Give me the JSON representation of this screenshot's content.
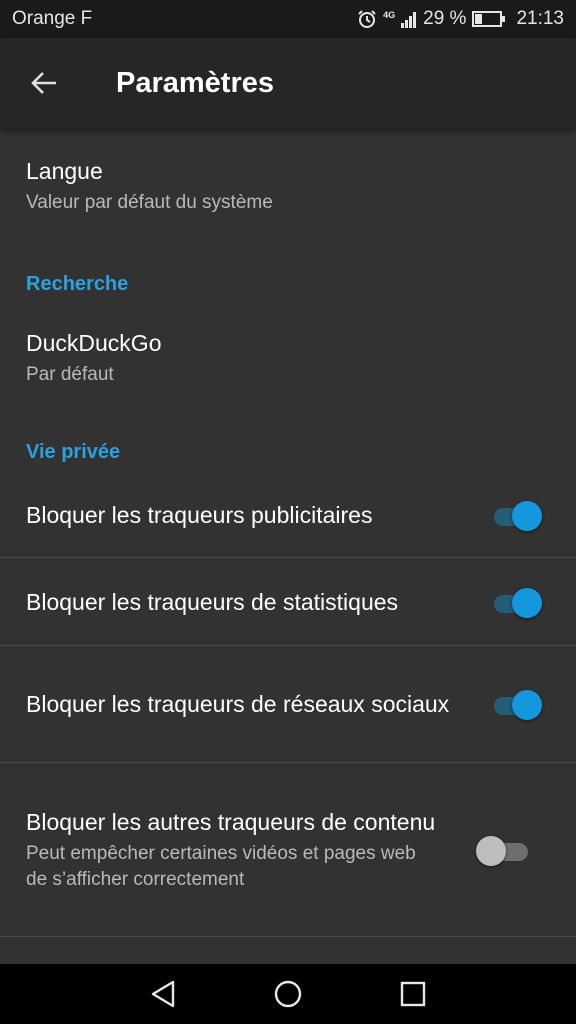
{
  "status_bar": {
    "carrier": "Orange F",
    "network": "4G",
    "battery": "29 %",
    "battery_level": 0.29,
    "time": "21:13"
  },
  "toolbar": {
    "title": "Paramètres"
  },
  "settings": {
    "language": {
      "title": "Langue",
      "summary": "Valeur par défaut du système"
    },
    "search_header": "Recherche",
    "search_engine": {
      "title": "DuckDuckGo",
      "summary": "Par défaut"
    },
    "privacy_header": "Vie privée",
    "privacy_toggles": [
      {
        "label": "Bloquer les traqueurs publicitaires",
        "enabled": true
      },
      {
        "label": "Bloquer les traqueurs de statistiques",
        "enabled": true
      },
      {
        "label": "Bloquer les traqueurs de réseaux sociaux",
        "enabled": true
      },
      {
        "label": "Bloquer les autres traqueurs de contenu",
        "summary": "Peut empêcher certaines vidéos et pages web de s’afficher correctement",
        "enabled": false
      }
    ]
  },
  "colors": {
    "accent": "#2aa1e0",
    "switch_on": "#1497dd",
    "background": "#323232",
    "toolbar": "#262626"
  },
  "icons": {
    "back": "arrow-back-icon",
    "alarm": "alarm-icon",
    "signal": "signal-icon",
    "battery": "battery-icon",
    "nav_back": "triangle-back-icon",
    "nav_home": "circle-home-icon",
    "nav_recents": "square-recents-icon"
  }
}
